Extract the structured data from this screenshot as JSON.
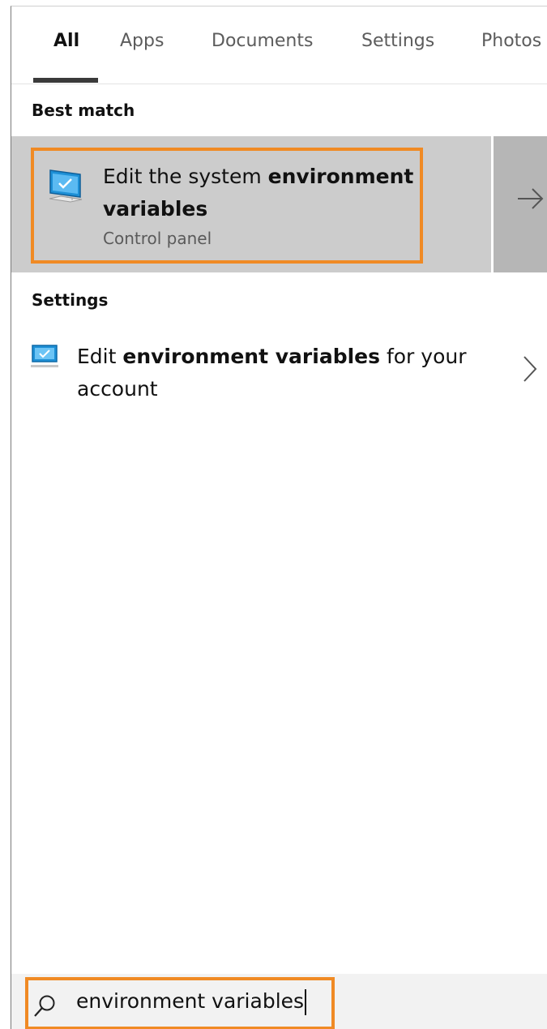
{
  "tabs": [
    {
      "label": "All",
      "active": true
    },
    {
      "label": "Apps",
      "active": false
    },
    {
      "label": "Documents",
      "active": false
    },
    {
      "label": "Settings",
      "active": false
    },
    {
      "label": "Photos",
      "active": false
    }
  ],
  "best_match": {
    "header": "Best match",
    "title_plain": "Edit the system ",
    "title_bold_1": "environment",
    "title_bold_2": "variables",
    "subtitle": "Control panel",
    "icon": "system-properties-computer-icon",
    "action_icon": "arrow-right-icon"
  },
  "settings": {
    "header": "Settings",
    "result": {
      "title_plain_1": "Edit ",
      "title_bold": "environment variables",
      "title_plain_2": " for your",
      "title_line2": "account",
      "icon": "monitor-settings-icon",
      "action_icon": "chevron-right-icon"
    }
  },
  "search": {
    "value": "environment variables",
    "icon": "search-icon"
  },
  "colors": {
    "highlight": "#f08a24",
    "selected_bg": "#cccccc",
    "arrow_bg": "#b6b6b6",
    "search_bg": "#f2f2f2",
    "icon_blue": "#1e90d6"
  }
}
